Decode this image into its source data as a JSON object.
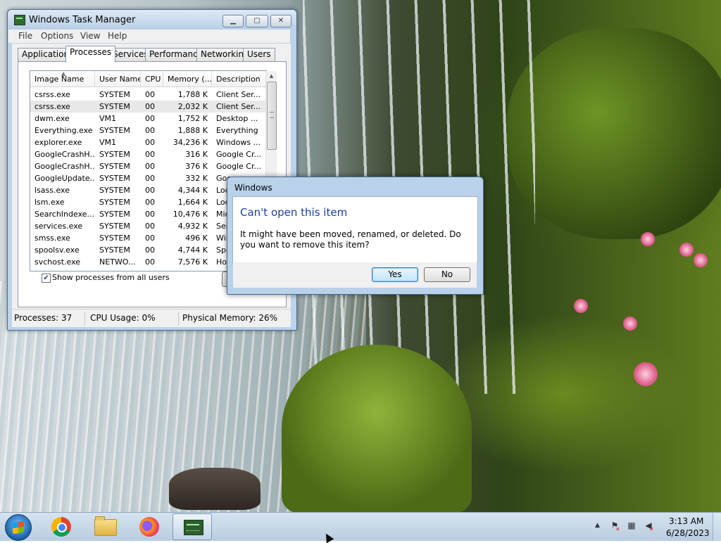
{
  "task_manager": {
    "title": "Windows Task Manager",
    "caption_buttons": {
      "minimize": "▁",
      "maximize": "▢",
      "close": "✕"
    },
    "menu": [
      "File",
      "Options",
      "View",
      "Help"
    ],
    "tabs": [
      "Applications",
      "Processes",
      "Services",
      "Performance",
      "Networking",
      "Users"
    ],
    "active_tab": "Processes",
    "columns": [
      "Image Name",
      "User Name",
      "CPU",
      "Memory (...",
      "Description"
    ],
    "rows": [
      [
        "csrss.exe",
        "SYSTEM",
        "00",
        "1,788 K",
        "Client Ser..."
      ],
      [
        "csrss.exe",
        "SYSTEM",
        "00",
        "2,032 K",
        "Client Ser..."
      ],
      [
        "dwm.exe",
        "VM1",
        "00",
        "1,752 K",
        "Desktop ..."
      ],
      [
        "Everything.exe",
        "SYSTEM",
        "00",
        "1,888 K",
        "Everything"
      ],
      [
        "explorer.exe",
        "VM1",
        "00",
        "34,236 K",
        "Windows ..."
      ],
      [
        "GoogleCrashH...",
        "SYSTEM",
        "00",
        "316 K",
        "Google Cr..."
      ],
      [
        "GoogleCrashH...",
        "SYSTEM",
        "00",
        "376 K",
        "Google Cr..."
      ],
      [
        "GoogleUpdate...",
        "SYSTEM",
        "00",
        "332 K",
        "Goo"
      ],
      [
        "lsass.exe",
        "SYSTEM",
        "00",
        "4,344 K",
        "Loc"
      ],
      [
        "lsm.exe",
        "SYSTEM",
        "00",
        "1,664 K",
        "Loc"
      ],
      [
        "SearchIndexe...",
        "SYSTEM",
        "00",
        "10,476 K",
        "Mic"
      ],
      [
        "services.exe",
        "SYSTEM",
        "00",
        "4,932 K",
        "Ser"
      ],
      [
        "smss.exe",
        "SYSTEM",
        "00",
        "496 K",
        "Win"
      ],
      [
        "spoolsv.exe",
        "SYSTEM",
        "00",
        "4,744 K",
        "Spo"
      ],
      [
        "svchost.exe",
        "NETWO...",
        "00",
        "7,576 K",
        "Hos"
      ]
    ],
    "selected_row": 1,
    "show_all_users_label": "Show processes from all users",
    "show_all_users_checked": true,
    "end_process_label": "E",
    "status": {
      "processes": "Processes: 37",
      "cpu": "CPU Usage: 0%",
      "memory": "Physical Memory: 26%"
    }
  },
  "dialog": {
    "title": "Windows",
    "heading": "Can't open this item",
    "message": "It might have been moved, renamed, or deleted. Do you want to remove this item?",
    "yes_label": "Yes",
    "no_label": "No"
  },
  "taskbar": {
    "pinned": [
      "chrome-icon",
      "file-explorer-icon",
      "firefox-icon",
      "task-manager-icon"
    ],
    "active": "task-manager-icon",
    "time": "3:13 AM",
    "date": "6/28/2023"
  }
}
